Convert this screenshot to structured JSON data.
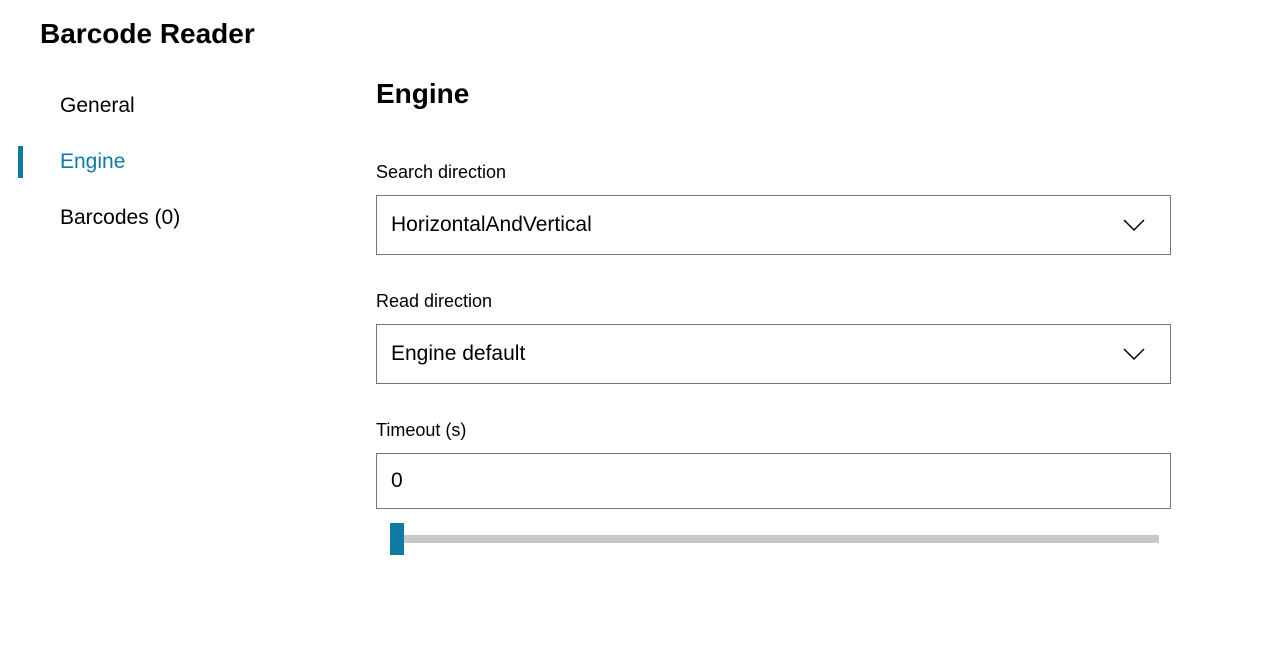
{
  "page": {
    "title": "Barcode Reader"
  },
  "sidebar": {
    "items": [
      {
        "label": "General",
        "active": false
      },
      {
        "label": "Engine",
        "active": true
      },
      {
        "label": "Barcodes (0)",
        "active": false
      }
    ]
  },
  "main": {
    "title": "Engine",
    "fields": {
      "search_direction": {
        "label": "Search direction",
        "value": "HorizontalAndVertical"
      },
      "read_direction": {
        "label": "Read direction",
        "value": "Engine default"
      },
      "timeout": {
        "label": "Timeout (s)",
        "value": "0"
      }
    }
  },
  "colors": {
    "accent": "#0f7ba5",
    "border": "#767676",
    "track": "#c8c8c8"
  }
}
